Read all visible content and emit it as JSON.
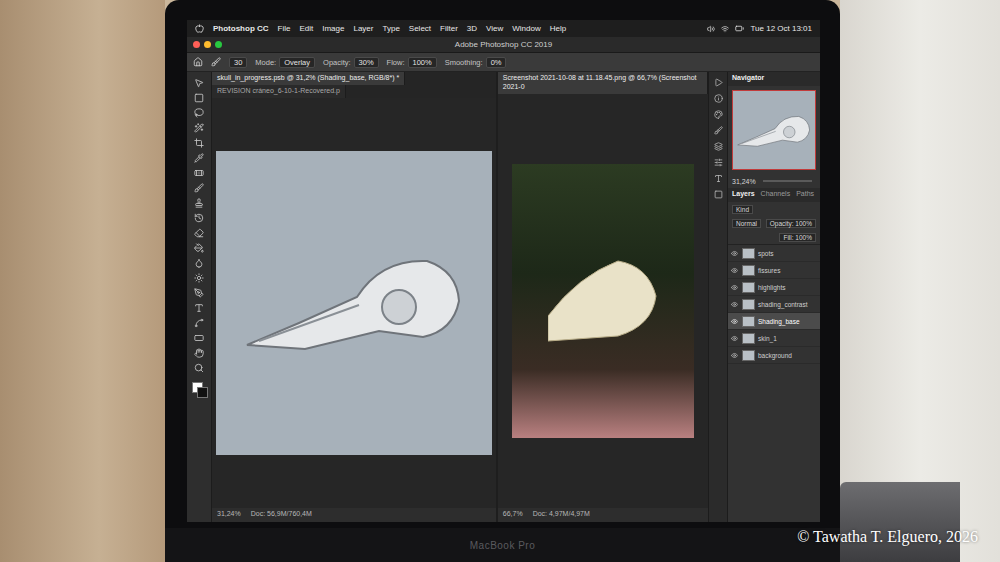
{
  "menu_bar": {
    "items": [
      "Photoshop CC",
      "File",
      "Edit",
      "Image",
      "Layer",
      "Type",
      "Select",
      "Filter",
      "3D",
      "View",
      "Window",
      "Help"
    ],
    "clock": "Tue 12 Oct 13:01"
  },
  "window": {
    "title": "Adobe Photoshop CC 2019"
  },
  "options_bar": {
    "brush_size": "30",
    "fields": [
      {
        "label": "Mode:",
        "value": "Overlay"
      },
      {
        "label": "Opacity:",
        "value": "30%"
      },
      {
        "label": "Flow:",
        "value": "100%"
      },
      {
        "label": "Smoothing:",
        "value": "0%"
      }
    ]
  },
  "panes": [
    {
      "kind": "drawing",
      "tabs": [
        {
          "label": "skull_in_progress.psb @ 31,2% (Shading_base, RGB/8*) *",
          "selected": true
        },
        {
          "label": "REVISION cráneo_6-10-1-Recovered.p",
          "selected": false
        }
      ],
      "zoom": "31,24%",
      "doc": "Doc: 56,9M/760,4M"
    },
    {
      "kind": "photo",
      "tabs": [
        {
          "label": "Screenshot 2021-10-08 at 11.18.45.png @ 66,7% (Screenshot 2021-0",
          "selected": true
        }
      ],
      "zoom": "66,7%",
      "doc": "Doc: 4,97M/4,97M"
    }
  ],
  "navigator": {
    "title": "Navigator",
    "zoom": "31,24%"
  },
  "layers_panel": {
    "tabs": [
      {
        "label": "Layers",
        "selected": true
      },
      {
        "label": "Channels",
        "selected": false
      },
      {
        "label": "Paths",
        "selected": false
      }
    ],
    "filter": "Kind",
    "blend_mode": "Normal",
    "opacity": "Opacity: 100%",
    "fill": "Fill: 100%",
    "layers": [
      {
        "name": "spots",
        "visible": true,
        "selected": false
      },
      {
        "name": "fissures",
        "visible": true,
        "selected": false
      },
      {
        "name": "highlights",
        "visible": true,
        "selected": false
      },
      {
        "name": "shading_contrast",
        "visible": true,
        "selected": false
      },
      {
        "name": "Shading_base",
        "visible": true,
        "selected": true
      },
      {
        "name": "skin_1",
        "visible": true,
        "selected": false
      },
      {
        "name": "background",
        "visible": true,
        "selected": false
      }
    ]
  },
  "device": {
    "label": "MacBook Pro"
  },
  "watermark": "© Tawatha T. Elguero, 2026"
}
